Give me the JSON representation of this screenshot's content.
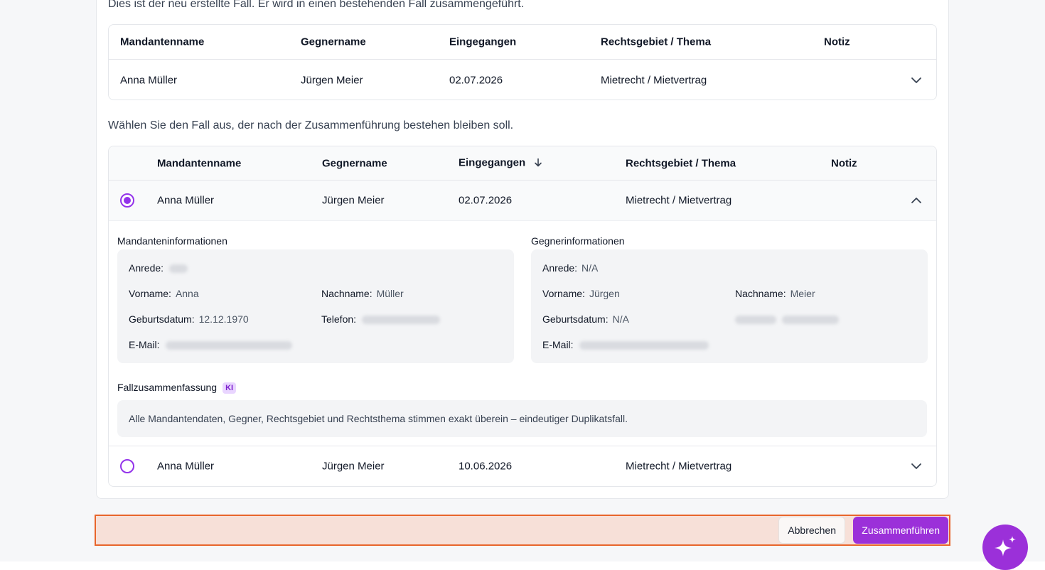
{
  "intro_text": "Dies ist der neu erstellte Fall. Er wird in einen bestehenden Fall zusammengeführt.",
  "new_case_table": {
    "headers": [
      "Mandantenname",
      "Gegnername",
      "Eingegangen",
      "Rechtsgebiet / Thema",
      "Notiz"
    ],
    "row": {
      "client": "Anna Müller",
      "opponent": "Jürgen Meier",
      "received": "02.07.2026",
      "area": "Mietrecht / Mietvertrag",
      "note": ""
    }
  },
  "select_text": "Wählen Sie den Fall aus, der nach der Zusammenführung bestehen bleiben soll.",
  "existing_table": {
    "headers": [
      "Mandantenname",
      "Gegnername",
      "Eingegangen",
      "Rechtsgebiet / Thema",
      "Notiz"
    ],
    "rows": [
      {
        "client": "Anna Müller",
        "opponent": "Jürgen Meier",
        "received": "02.07.2026",
        "area": "Mietrecht / Mietvertrag",
        "selected": true,
        "expanded": true
      },
      {
        "client": "Anna Müller",
        "opponent": "Jürgen Meier",
        "received": "10.06.2026",
        "area": "Mietrecht / Mietvertrag",
        "selected": false,
        "expanded": false
      }
    ]
  },
  "details": {
    "client_title": "Mandanteninformationen",
    "opponent_title": "Gegnerinformationen",
    "client": {
      "salutation_label": "Anrede:",
      "first_name_label": "Vorname:",
      "first_name": "Anna",
      "last_name_label": "Nachname:",
      "last_name": "Müller",
      "birthdate_label": "Geburtsdatum:",
      "birthdate": "12.12.1970",
      "phone_label": "Telefon:",
      "email_label": "E-Mail:"
    },
    "opponent": {
      "salutation_label": "Anrede:",
      "salutation": "N/A",
      "first_name_label": "Vorname:",
      "first_name": "Jürgen",
      "last_name_label": "Nachname:",
      "last_name": "Meier",
      "birthdate_label": "Geburtsdatum:",
      "birthdate": "N/A",
      "email_label": "E-Mail:"
    },
    "summary_title": "Fallzusammenfassung",
    "ki_badge": "KI",
    "summary_text": "Alle Mandantendaten, Gegner, Rechtsgebiet und Rechtsthema stimmen exakt überein – eindeutiger Duplikatsfall."
  },
  "footer": {
    "cancel_label": "Abbrechen",
    "merge_label": "Zusammenführen"
  },
  "colors": {
    "accent": "#9b30d9",
    "footer_bg": "#f7e0d8",
    "footer_border": "#e8652b"
  }
}
